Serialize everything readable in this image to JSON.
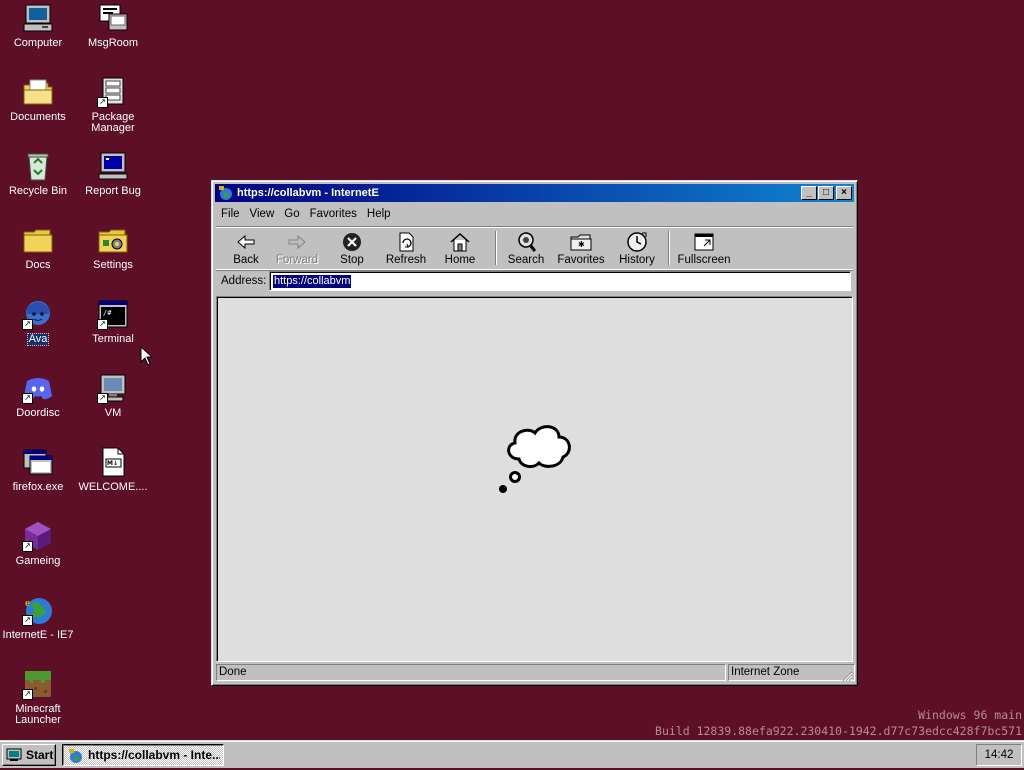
{
  "desktop": {
    "icons": [
      {
        "label": "Computer"
      },
      {
        "label": "MsgRoom"
      },
      {
        "label": "Documents"
      },
      {
        "label": "Package Manager"
      },
      {
        "label": "Recycle Bin"
      },
      {
        "label": "Report Bug"
      },
      {
        "label": "Docs"
      },
      {
        "label": "Settings"
      },
      {
        "label": "Ava"
      },
      {
        "label": "Terminal"
      },
      {
        "label": "Doordisc"
      },
      {
        "label": "VM"
      },
      {
        "label": "firefox.exe"
      },
      {
        "label": "WELCOME...."
      },
      {
        "label": "Gameing"
      },
      {
        "label": "InternetE - IE7"
      },
      {
        "label": "Minecraft Launcher"
      }
    ],
    "watermark": {
      "line1": "Windows 96 main",
      "line2": "Build 12839.88efa922.230410-1942.d77c73edcc428f7bc571"
    }
  },
  "window": {
    "title": "https://collabvm - InternetE",
    "menu": [
      "File",
      "View",
      "Go",
      "Favorites",
      "Help"
    ],
    "toolbar": {
      "back": "Back",
      "forward": "Forward",
      "stop": "Stop",
      "refresh": "Refresh",
      "home": "Home",
      "search": "Search",
      "favorites": "Favorites",
      "history": "History",
      "fullscreen": "Fullscreen"
    },
    "address": {
      "label": "Address:",
      "value": "https://collabvm"
    },
    "status": {
      "text": "Done",
      "zone": "Internet Zone"
    }
  },
  "taskbar": {
    "start_label": "Start",
    "task_label": "https://collabvm - Inte...",
    "clock": "14:42"
  },
  "colors": {
    "desktop": "#5e0f28",
    "titlebar_start": "#000080",
    "titlebar_end": "#1084d0"
  }
}
